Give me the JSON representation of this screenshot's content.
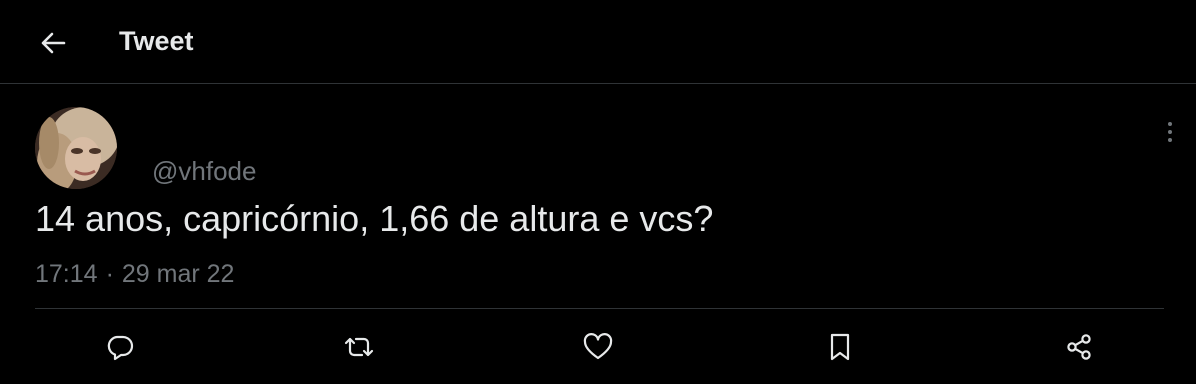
{
  "header": {
    "back_icon": "arrow-left-icon",
    "title": "Tweet"
  },
  "tweet": {
    "handle": "@vhfode",
    "text": "14 anos, capricórnio, 1,66 de altura e vcs?",
    "time": "17:14",
    "separator": "·",
    "date": "29 mar 22",
    "more_icon": "more-vertical-icon"
  },
  "actions": [
    {
      "name": "reply",
      "icon": "reply-icon"
    },
    {
      "name": "retweet",
      "icon": "retweet-icon"
    },
    {
      "name": "like",
      "icon": "heart-icon"
    },
    {
      "name": "bookmark",
      "icon": "bookmark-icon"
    },
    {
      "name": "share",
      "icon": "share-icon"
    }
  ],
  "colors": {
    "background": "#000000",
    "text": "#e7e9ea",
    "secondary": "#71767b",
    "border": "#2f3336"
  }
}
